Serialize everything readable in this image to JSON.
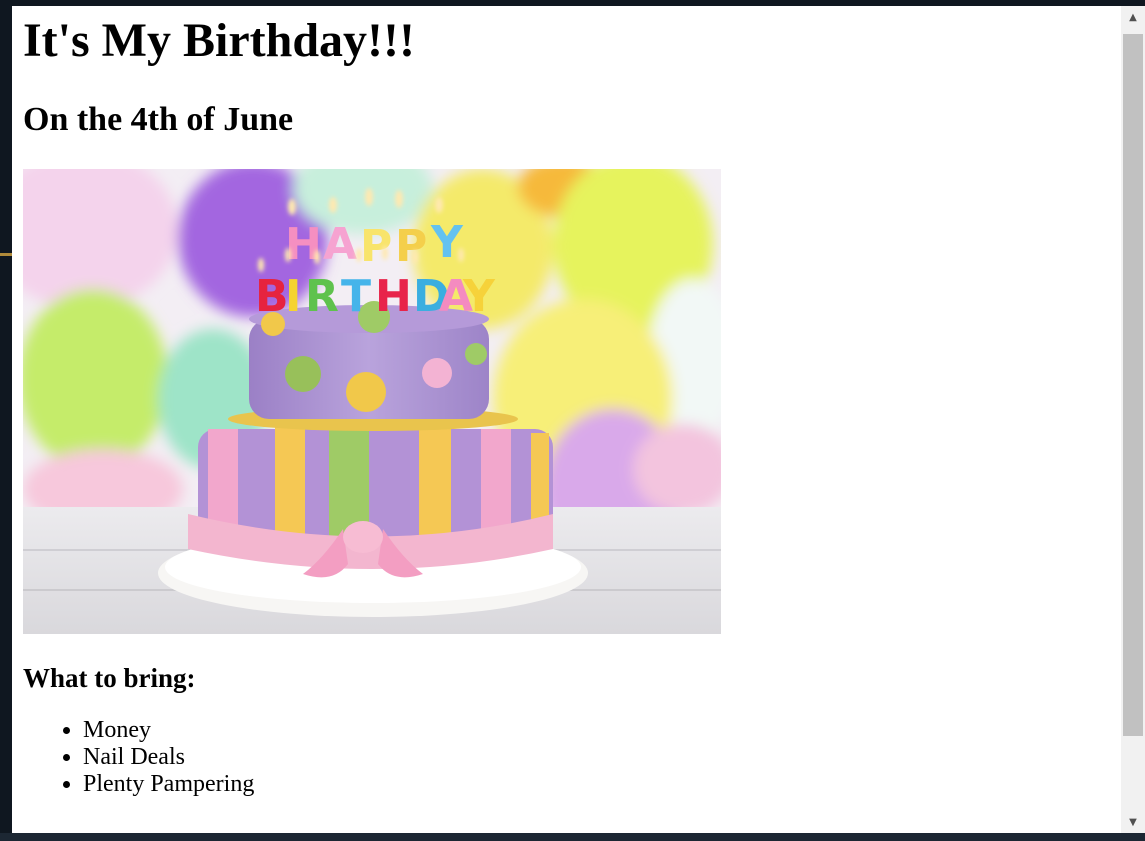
{
  "page": {
    "title": "It's My Birthday!!!",
    "subtitle": "On the 4th of June",
    "section_heading": "What to bring:",
    "items": [
      "Money",
      "Nail Deals",
      "Plenty Pampering"
    ]
  },
  "image": {
    "subject": "birthday-cake-photo",
    "candle_text_top": "HAPPY",
    "candle_text_bottom": "BIRTHDAY"
  },
  "scrollbar": {
    "up_icon": "▲",
    "down_icon": "▼"
  },
  "colors": {
    "frame": "#0f1720",
    "page_bg": "#ffffff",
    "scroll_track": "#f1f1f1",
    "scroll_thumb": "#c1c1c1"
  }
}
